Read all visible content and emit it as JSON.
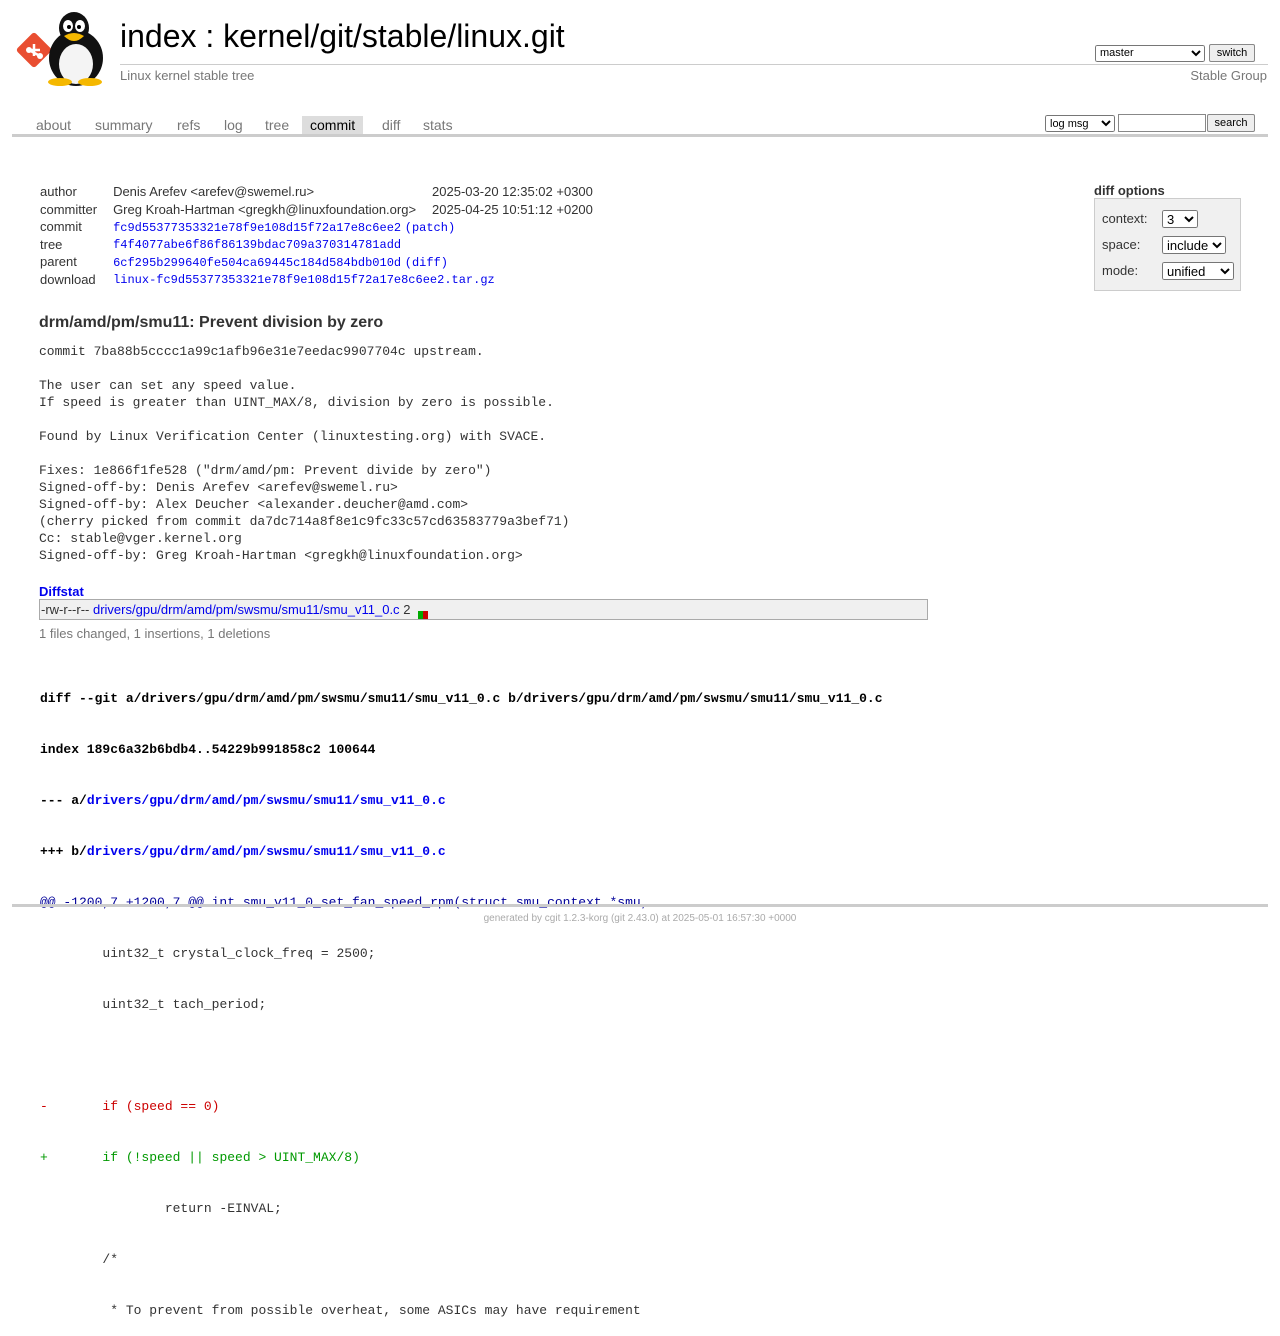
{
  "header": {
    "title_index": "index",
    "title_sep": " : ",
    "title_repo": "kernel/git/stable/linux.git",
    "subtitle": "Linux kernel stable tree",
    "owner": "Stable Group",
    "branch": "master",
    "switch_label": "switch"
  },
  "tabs": [
    {
      "label": "about"
    },
    {
      "label": "summary"
    },
    {
      "label": "refs"
    },
    {
      "label": "log"
    },
    {
      "label": "tree"
    },
    {
      "label": "commit"
    },
    {
      "label": "diff"
    },
    {
      "label": "stats"
    }
  ],
  "active_tab": "commit",
  "search": {
    "scope": "log msg",
    "value": "",
    "button_label": "search"
  },
  "commit_info": {
    "author_label": "author",
    "author": "Denis Arefev <arefev@swemel.ru>",
    "author_date": "2025-03-20 12:35:02 +0300",
    "committer_label": "committer",
    "committer": "Greg Kroah-Hartman <gregkh@linuxfoundation.org>",
    "committer_date": "2025-04-25 10:51:12 +0200",
    "commit_label": "commit",
    "commit": "fc9d55377353321e78f9e108d15f72a17e8c6ee2",
    "patch_link": "patch",
    "tree_label": "tree",
    "tree": "f4f4077abe6f86f86139bdac709a370314781add",
    "parent_label": "parent",
    "parent": "6cf295b299640fe504ca69445c184d584bdb010d",
    "diff_link": "diff",
    "download_label": "download",
    "download": "linux-fc9d55377353321e78f9e108d15f72a17e8c6ee2.tar.gz"
  },
  "diff_options": {
    "title": "diff options",
    "context_label": "context:",
    "context": "3",
    "space_label": "space:",
    "space": "include",
    "mode_label": "mode:",
    "mode": "unified"
  },
  "subject": "drm/amd/pm/smu11: Prevent division by zero",
  "message": "commit 7ba88b5cccc1a99c1afb96e31e7eedac9907704c upstream.\n\nThe user can set any speed value.\nIf speed is greater than UINT_MAX/8, division by zero is possible.\n\nFound by Linux Verification Center (linuxtesting.org) with SVACE.\n\nFixes: 1e866f1fe528 (\"drm/amd/pm: Prevent divide by zero\")\nSigned-off-by: Denis Arefev <arefev@swemel.ru>\nSigned-off-by: Alex Deucher <alexander.deucher@amd.com>\n(cherry picked from commit da7dc714a8f8e1c9fc33c57cd63583779a3bef71)\nCc: stable@vger.kernel.org\nSigned-off-by: Greg Kroah-Hartman <gregkh@linuxfoundation.org>",
  "diffstat": {
    "header": "Diffstat",
    "mode": "-rw-r--r--",
    "file": "drivers/gpu/drm/amd/pm/swsmu/smu11/smu_v11_0.c",
    "changes": "2",
    "insertions": 1,
    "deletions": 1,
    "summary": "1 files changed, 1 insertions, 1 deletions"
  },
  "diff": {
    "git_line": "diff --git a/drivers/gpu/drm/amd/pm/swsmu/smu11/smu_v11_0.c b/drivers/gpu/drm/amd/pm/swsmu/smu11/smu_v11_0.c",
    "index_line": "index 189c6a32b6bdb4..54229b991858c2 100644",
    "minus_prefix": "--- a/",
    "minus_file": "drivers/gpu/drm/amd/pm/swsmu/smu11/smu_v11_0.c",
    "plus_prefix": "+++ b/",
    "plus_file": "drivers/gpu/drm/amd/pm/swsmu/smu11/smu_v11_0.c",
    "hunk": "@@ -1200,7 +1200,7 @@ int smu_v11_0_set_fan_speed_rpm(struct smu_context *smu,",
    "lines": [
      {
        "type": "ctx",
        "text": " \tuint32_t crystal_clock_freq = 2500;"
      },
      {
        "type": "ctx",
        "text": " \tuint32_t tach_period;"
      },
      {
        "type": "ctx",
        "text": " "
      },
      {
        "type": "del",
        "text": "-\tif (speed == 0)"
      },
      {
        "type": "add",
        "text": "+\tif (!speed || speed > UINT_MAX/8)"
      },
      {
        "type": "ctx",
        "text": " \t\treturn -EINVAL;"
      },
      {
        "type": "ctx",
        "text": " \t/*"
      },
      {
        "type": "ctx",
        "text": " \t * To prevent from possible overheat, some ASICs may have requirement"
      }
    ]
  },
  "footer": {
    "prefix": "generated by ",
    "cgit_link": "cgit 1.2.3-korg",
    "git_part": " (git 2.43.0) at 2025-05-01 16:57:30 +0000"
  },
  "colors": {
    "link": "#0000ee",
    "add": "#009900",
    "del": "#cc0000",
    "hunk": "#000099",
    "tab_active_bg": "#dddddd"
  }
}
